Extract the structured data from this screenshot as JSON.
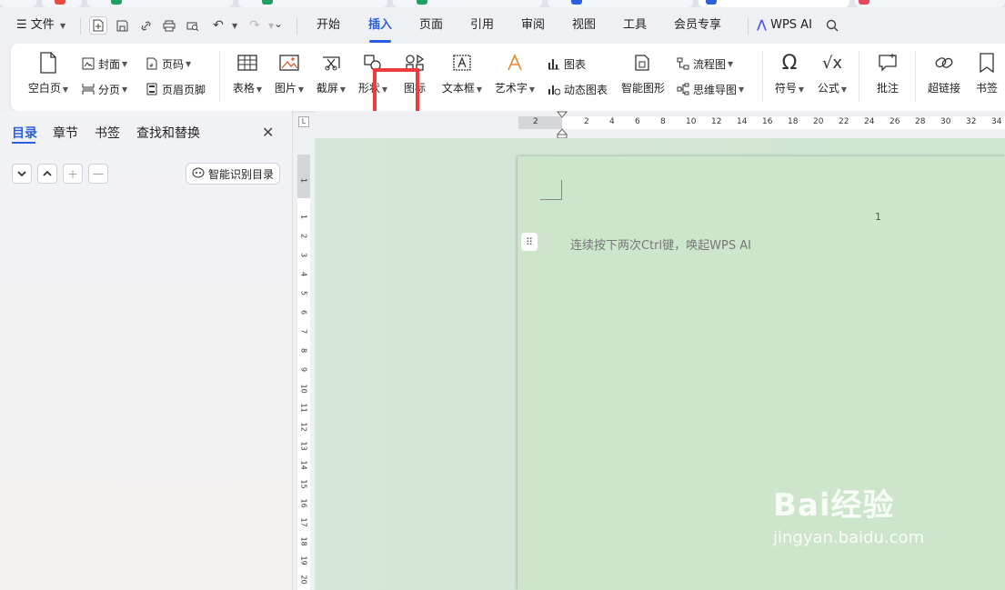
{
  "menubar": {
    "file_label": "文件",
    "tabs": [
      "开始",
      "插入",
      "页面",
      "引用",
      "审阅",
      "视图",
      "工具",
      "会员专享"
    ],
    "active_tab": "插入",
    "wps_ai_label": "WPS AI"
  },
  "ribbon": {
    "blank_page": "空白页",
    "cover": "封面",
    "page_number": "页码",
    "page_break": "分页",
    "header_footer": "页眉页脚",
    "table": "表格",
    "picture": "图片",
    "screenshot": "截屏",
    "shape": "形状",
    "icon": "图标",
    "text_box": "文本框",
    "word_art": "艺术字",
    "chart": "图表",
    "dynamic_chart": "动态图表",
    "smart_graphic": "智能图形",
    "flowchart": "流程图",
    "mind_map": "思维导图",
    "symbol": "符号",
    "formula": "公式",
    "comment": "批注",
    "hyperlink": "超链接",
    "bookmark": "书签"
  },
  "leftpanel": {
    "tabs": [
      "目录",
      "章节",
      "书签",
      "查找和替换"
    ],
    "smart_toc_button": "智能识别目录"
  },
  "ruler": {
    "h_numbers": [
      "2",
      "2",
      "4",
      "6",
      "8",
      "10",
      "12",
      "14",
      "16",
      "18",
      "20",
      "22",
      "24",
      "26",
      "28",
      "30",
      "32",
      "34"
    ],
    "v_numbers": [
      "1",
      "1",
      "2",
      "3",
      "4",
      "5",
      "6",
      "7",
      "8",
      "9",
      "10",
      "11",
      "12",
      "13",
      "14",
      "15",
      "16",
      "17",
      "18",
      "19",
      "20"
    ],
    "corner": "L"
  },
  "document": {
    "page_number": "1",
    "hint": "连续按下两次Ctrl键，唤起WPS AI"
  },
  "watermark": {
    "brand": "Bai经验",
    "url": "jingyan.baidu.com"
  },
  "colors": {
    "accent": "#2b5fe0",
    "highlight_box": "#f23b3b",
    "doc_bg": "#cde6cb"
  }
}
